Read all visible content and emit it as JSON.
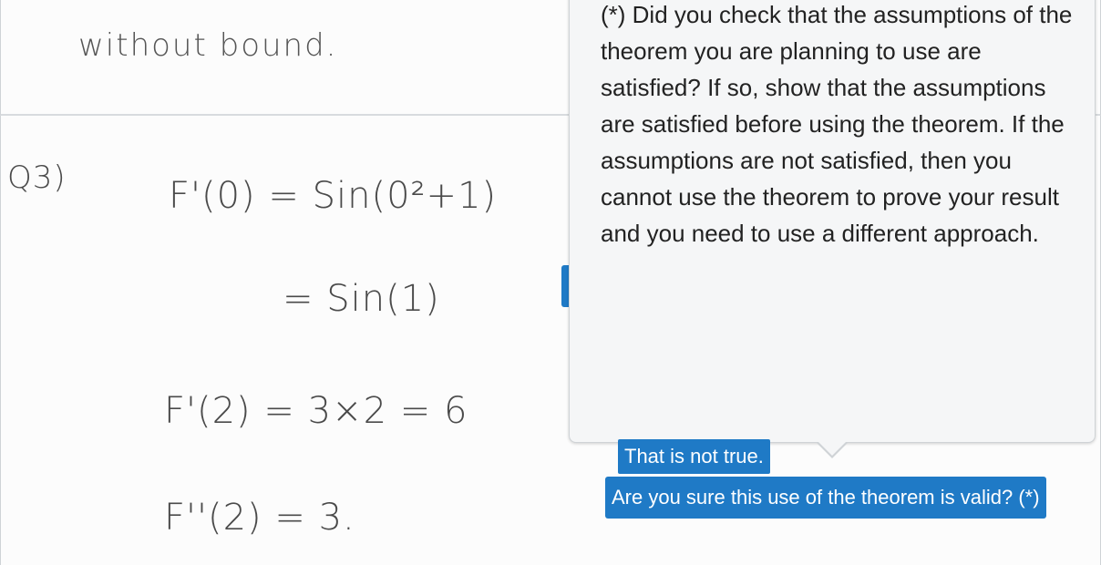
{
  "page": {
    "top_text": "without bound.",
    "question_label": "Q3)",
    "lines": [
      "F'(0) = Sin(0²+1)",
      "= Sin(1)",
      "F'(2) = 3×2 = 6",
      "F''(2) = 3."
    ]
  },
  "popover": {
    "text": "(*) Did you check that the assumptions of the theorem you are planning to use are satisfied? If so, show that the assumptions are satisfied before using the theorem. If the assumptions are not satisfied, then you cannot use the theorem to prove your result and you need to use a different approach."
  },
  "comments": [
    {
      "label": "That is not true."
    },
    {
      "label": "Are you sure this use of the theorem is valid? (*)"
    }
  ],
  "colors": {
    "comment_bg": "#1f7ac6",
    "popover_bg": "#f5f6f7"
  }
}
